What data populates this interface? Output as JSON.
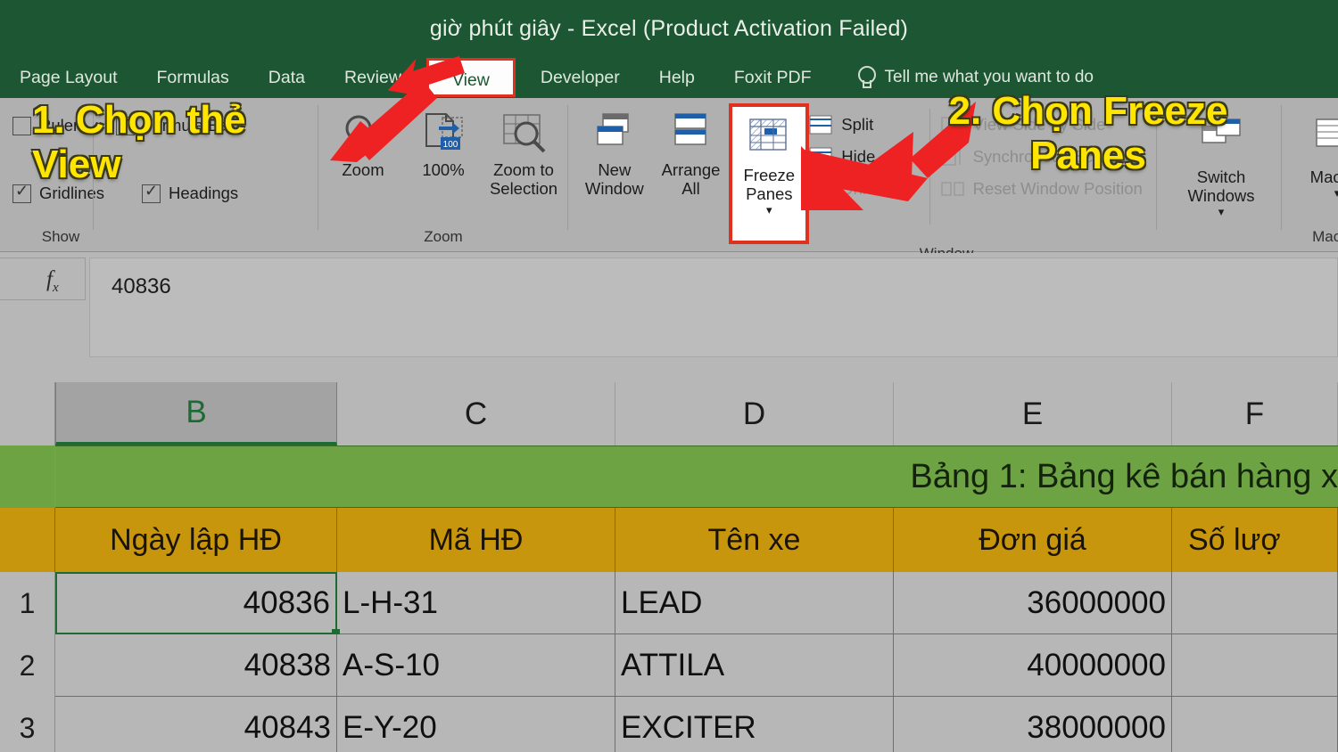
{
  "window": {
    "title": "giờ phút giây  -  Excel (Product Activation Failed)"
  },
  "tabs": [
    {
      "label": "Page Layout",
      "active": false
    },
    {
      "label": "Formulas",
      "active": false
    },
    {
      "label": "Data",
      "active": false
    },
    {
      "label": "Review",
      "active": false
    },
    {
      "label": "View",
      "active": true
    },
    {
      "label": "Developer",
      "active": false
    },
    {
      "label": "Help",
      "active": false
    },
    {
      "label": "Foxit PDF",
      "active": false
    }
  ],
  "tellme": {
    "icon": "lightbulb-icon",
    "placeholder": "Tell me what you want to do"
  },
  "ribbon": {
    "show_group": {
      "label": "Show",
      "items": [
        {
          "label": "Ruler",
          "checked": false
        },
        {
          "label": "Formula Bar",
          "checked": true
        },
        {
          "label": "Gridlines",
          "checked": true
        },
        {
          "label": "Headings",
          "checked": true
        }
      ]
    },
    "zoom_group": {
      "label": "Zoom",
      "items": [
        {
          "label": "Zoom",
          "icon": "magnifier-icon"
        },
        {
          "label": "100%",
          "icon": "zoom-100-icon"
        },
        {
          "label": "Zoom to\nSelection",
          "icon": "zoom-selection-icon"
        }
      ]
    },
    "window_group": {
      "label": "Window",
      "items": [
        {
          "label": "New\nWindow",
          "icon": "new-window-icon"
        },
        {
          "label": "Arrange\nAll",
          "icon": "arrange-all-icon"
        },
        {
          "label": "Freeze\nPanes",
          "icon": "freeze-panes-icon",
          "caret": "▾",
          "highlighted": true
        }
      ],
      "small_items": [
        {
          "label": "Split",
          "disabled": false
        },
        {
          "label": "Hide",
          "disabled": false
        },
        {
          "label": "Unhide",
          "disabled": true
        }
      ],
      "side_items": [
        {
          "label": "View Side by Side",
          "disabled": true
        },
        {
          "label": "Synchronous Scrolling",
          "disabled": true
        },
        {
          "label": "Reset Window Position",
          "disabled": true
        }
      ],
      "switch_windows": {
        "label": "Switch\nWindows",
        "caret": "▾",
        "icon": "switch-windows-icon"
      }
    },
    "macros_group": {
      "label": "Macros",
      "button": {
        "label": "Macros",
        "caret": "▾",
        "icon": "macros-icon"
      }
    }
  },
  "formula_bar": {
    "name_box_value": "",
    "fx_label": "fx",
    "value": "40836"
  },
  "sheet": {
    "columns": [
      {
        "label": "B",
        "selected": true
      },
      {
        "label": "C",
        "selected": false
      },
      {
        "label": "D",
        "selected": false
      },
      {
        "label": "E",
        "selected": false
      },
      {
        "label": "F",
        "selected": false
      }
    ],
    "title_row": {
      "text": "Bảng 1: Bảng kê bán hàng x"
    },
    "header_row": [
      "Ngày lập HĐ",
      "Mã HĐ",
      "Tên xe",
      "Đơn giá",
      "Số lượ"
    ],
    "rows": [
      {
        "num": "1",
        "cells": [
          "40836",
          "L-H-31",
          "LEAD",
          "36000000",
          ""
        ],
        "active_cell": 0
      },
      {
        "num": "2",
        "cells": [
          "40838",
          "A-S-10",
          "ATTILA",
          "40000000",
          ""
        ],
        "active_cell": -1
      },
      {
        "num": "3",
        "cells": [
          "40843",
          "E-Y-20",
          "EXCITER",
          "38000000",
          ""
        ],
        "active_cell": -1
      }
    ]
  },
  "annotations": [
    {
      "id": "step-1",
      "text": "1. Chọn thẻ\nView"
    },
    {
      "id": "step-2",
      "text": "2. Chọn Freeze\nPanes"
    }
  ],
  "colors": {
    "title_bar": "#1d5632",
    "ribbon": "#b0b0b0",
    "highlight_red": "#e03020",
    "annotation_yellow": "#ffe500",
    "table_title_green": "#6ea344",
    "table_header_gold": "#c8960c",
    "selection_green": "#1d6b33"
  }
}
